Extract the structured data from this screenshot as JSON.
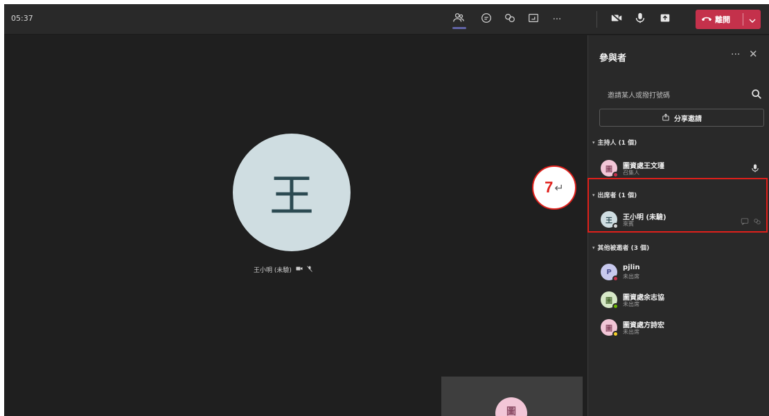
{
  "timer": "05:37",
  "toolbar": {
    "icons": [
      "participants-icon",
      "chat-icon",
      "reactions-icon",
      "share-tray-icon",
      "more-icon",
      "camera-off-icon",
      "mic-icon",
      "share-content-icon"
    ],
    "more_label": "···",
    "leave_label": "離開"
  },
  "stage": {
    "avatar_initial": "王",
    "name_label": "王小明 (未驗)"
  },
  "self_preview": {
    "avatar_initial": "圖"
  },
  "panel": {
    "title": "參與者",
    "more_label": "···",
    "close_label": "✕",
    "invite_placeholder": "邀請某人或撥打號碼",
    "share_invite_label": "分享邀請",
    "sections": {
      "organizer": "主持人 (1 個)",
      "attendees": "出席者 (1 個)",
      "others": "其他被邀者 (3 個)"
    },
    "people": {
      "organizer": {
        "initial": "圖",
        "name": "圖資處王文瑾",
        "role": "召集人",
        "avatar_bg": "#f2c6d7",
        "status": "#c4314b"
      },
      "attendee": {
        "initial": "王",
        "name": "王小明 (未驗)",
        "role": "來賓",
        "avatar_bg": "#cfdde1",
        "status": "#d6d6d6"
      },
      "other1": {
        "initial": "P",
        "name": "pjlin",
        "role": "未出席",
        "avatar_bg": "#c8c9ee",
        "status": "#c4314b"
      },
      "other2": {
        "initial": "圖",
        "name": "圖資處余志協",
        "role": "未出席",
        "avatar_bg": "#d7e8c8",
        "status": "#6bb700"
      },
      "other3": {
        "initial": "圖",
        "name": "圖資處方詩宏",
        "role": "未出席",
        "avatar_bg": "#f2c6d7",
        "status": "#f8d22a"
      }
    }
  },
  "callout": {
    "number": "7",
    "arrow": "↵"
  }
}
